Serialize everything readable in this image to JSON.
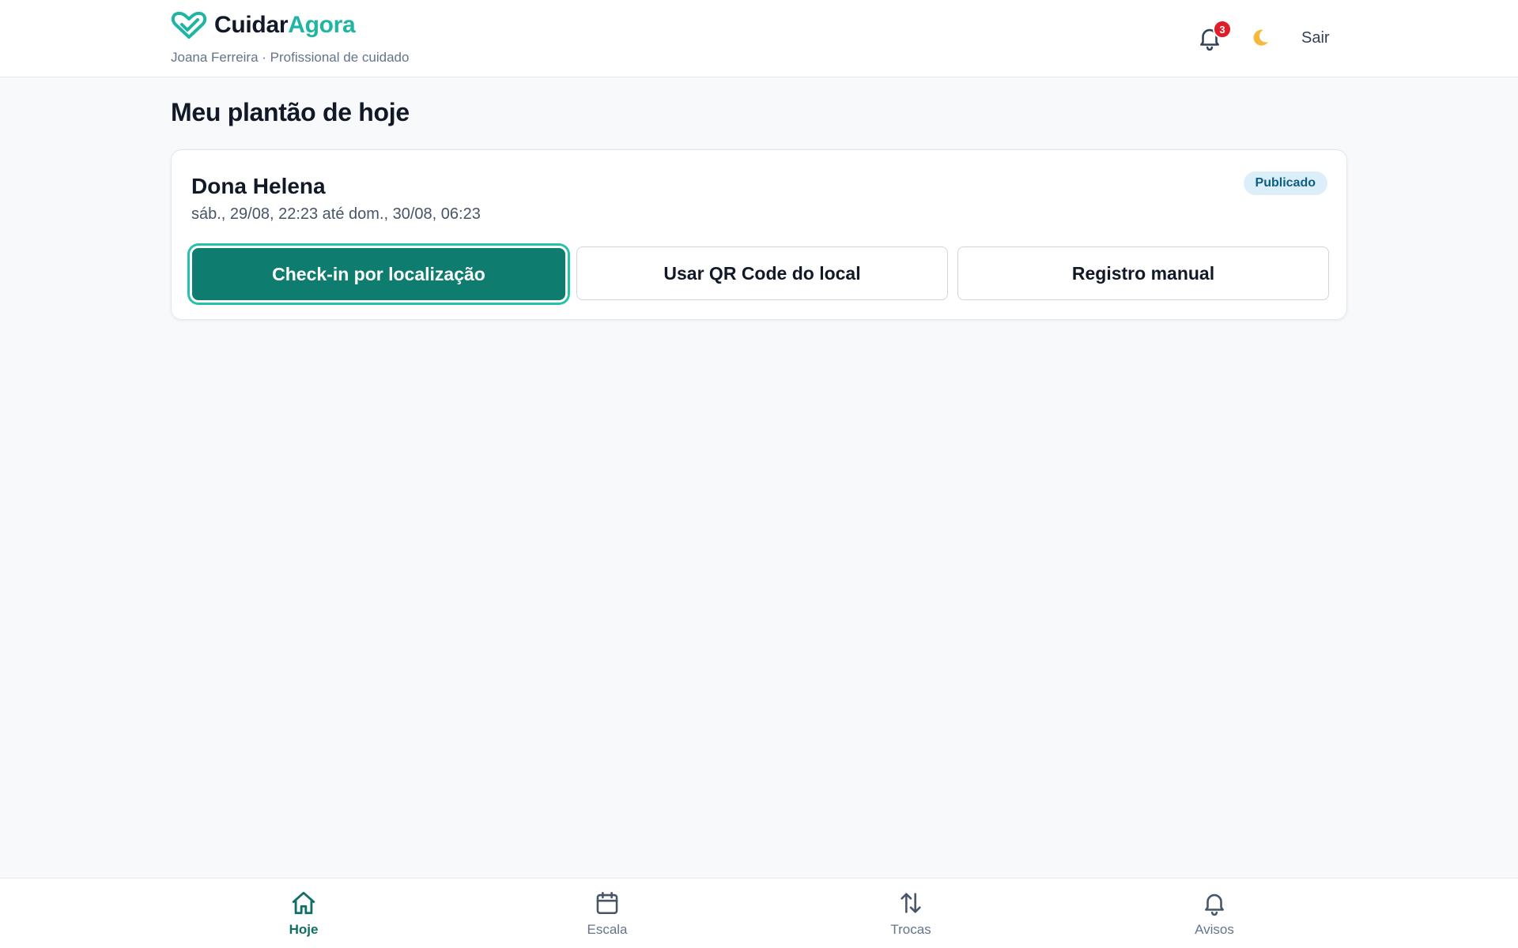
{
  "header": {
    "brand_part1": "Cuidar",
    "brand_part2": "Agora",
    "user_line": "Joana Ferreira · Profissional de cuidado",
    "notifications_count": "3",
    "logout_label": "Sair"
  },
  "main": {
    "title": "Meu plantão de hoje",
    "shift": {
      "patient": "Dona Helena",
      "time": "sáb., 29/08, 22:23 até dom., 30/08, 06:23",
      "status": "Publicado",
      "actions": [
        {
          "label": "Check-in por localização"
        },
        {
          "label": "Usar QR Code do local"
        },
        {
          "label": "Registro manual"
        }
      ]
    }
  },
  "bottom_nav": {
    "items": [
      {
        "label": "Hoje",
        "icon": "home-icon",
        "active": true
      },
      {
        "label": "Escala",
        "icon": "calendar-icon",
        "active": false
      },
      {
        "label": "Trocas",
        "icon": "swap-icon",
        "active": false
      },
      {
        "label": "Avisos",
        "icon": "bell-icon",
        "active": false
      }
    ]
  },
  "colors": {
    "brand_accent": "#1fb5a3",
    "primary_button": "#0e7c6f",
    "notification_badge": "#e11d2a",
    "status_badge_bg": "#dbeefa"
  }
}
